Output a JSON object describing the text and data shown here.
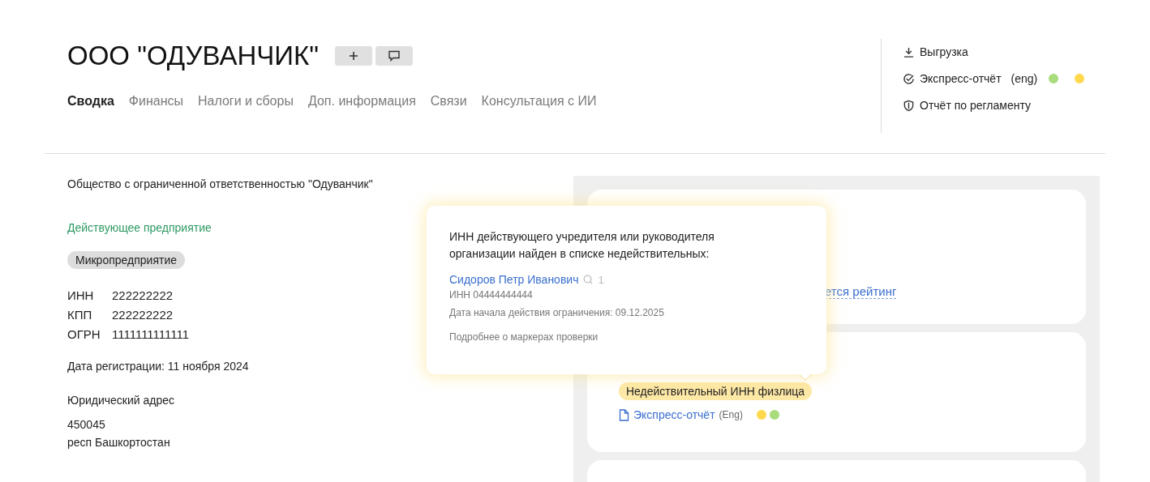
{
  "company": {
    "title": "ООО \"ОДУВАНЧИК\"",
    "full_name": "Общество с ограниченной ответственностью \"Одуванчик\"",
    "status": "Действующее предприятие",
    "category": "Микропредприятие",
    "identifiers": [
      {
        "label": "ИНН",
        "value": "222222222"
      },
      {
        "label": "КПП",
        "value": "222222222"
      },
      {
        "label": "ОГРН",
        "value": "1111111111111"
      }
    ],
    "registration": "Дата регистрации: 11 ноября 2024",
    "address_label": "Юридический адрес",
    "address_lines": [
      "450045",
      "респ Башкортостан"
    ]
  },
  "tabs": [
    {
      "label": "Сводка",
      "selected": true
    },
    {
      "label": "Финансы",
      "selected": false
    },
    {
      "label": "Налоги и сборы",
      "selected": false
    },
    {
      "label": "Доп. информация",
      "selected": false
    },
    {
      "label": "Связи",
      "selected": false
    },
    {
      "label": "Консультация с ИИ",
      "selected": false
    }
  ],
  "actions": [
    {
      "kind": "download",
      "label": "Выгрузка"
    },
    {
      "kind": "express",
      "label": "Экспресс-отчёт",
      "suffix": "(eng)",
      "dots": [
        {
          "color": "#a8dc7c"
        },
        {
          "color": "#ffd84d"
        }
      ]
    },
    {
      "kind": "regulation",
      "label": "Отчёт по регламенту"
    }
  ],
  "rating_card": {
    "link": "ется рейтинг"
  },
  "marker_card": {
    "badge": "Недействительный ИНН физлица",
    "report": {
      "label": "Экспресс-отчёт",
      "suffix": "(Eng)",
      "dots": [
        {
          "color": "#ffd84d"
        },
        {
          "color": "#a8dc7c"
        }
      ]
    }
  },
  "popover": {
    "message": "ИНН действующего учредителя или руководителя организации найден в списке недействительных:",
    "person": {
      "name": "Сидоров Петр Иванович",
      "count": "1",
      "inn": "ИНН 04444444444",
      "restriction": "Дата начала действия ограничения: 09.12.2025"
    },
    "more": "Подробнее о маркерах проверки"
  }
}
